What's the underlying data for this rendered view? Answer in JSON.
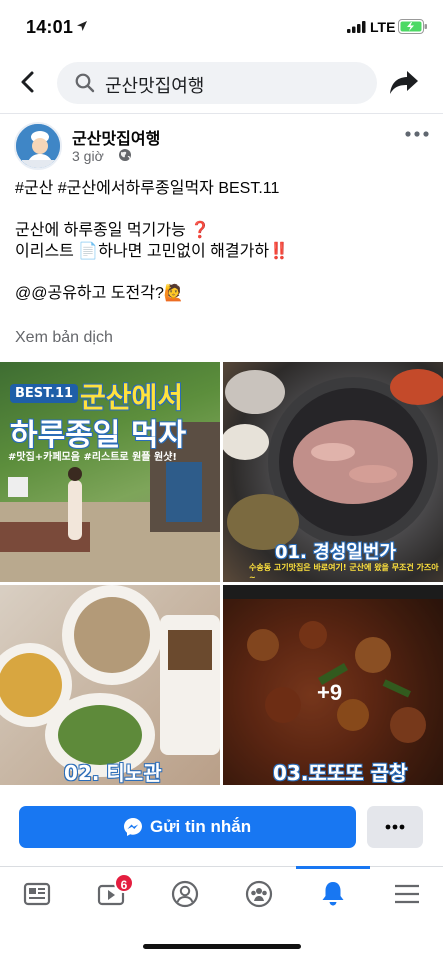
{
  "status_bar": {
    "time": "14:01",
    "network": "LTE",
    "battery_color": "#4cd964"
  },
  "search": {
    "query": "군산맛집여행"
  },
  "post": {
    "author": "군산맛집여행",
    "avatar_label": "맛집여행",
    "time": "3 giờ",
    "privacy_icon": "globe-icon",
    "lines": [
      "#군산 #군산에서하루종일먹자 BEST.11",
      "군산에 하루종일 먹기가능 ❓",
      "이리스트 📄하나면 고민없이 해결가하‼️",
      "@@공유하고 도전각?🙋"
    ],
    "see_translation": "Xem bản dịch",
    "photos": [
      {
        "badge": "BEST.11",
        "title_line1": "군산에서",
        "title_line2": "하루종일 먹자",
        "subtitle": "#맛집+카페모음 #리스트로 원플 원샷!"
      },
      {
        "caption": "01. 경성일번가",
        "subcaption": "수송동 고기맛집은 바로여기! 군산에 왔을 무조건 가즈아~"
      },
      {
        "caption": "02. 티노관"
      },
      {
        "caption": "03.또또또 곱창",
        "more_count": "+9"
      }
    ]
  },
  "actions": {
    "message_label": "Gửi tin nhắn",
    "more_label": "•••"
  },
  "tab_bar": {
    "accent_color": "#1877f2",
    "tabs": [
      {
        "name": "news-feed",
        "icon": "news-feed-icon"
      },
      {
        "name": "watch",
        "icon": "video-icon",
        "badge": "6"
      },
      {
        "name": "profile",
        "icon": "profile-icon"
      },
      {
        "name": "groups",
        "icon": "groups-icon"
      },
      {
        "name": "notifications",
        "icon": "bell-icon",
        "active": true
      },
      {
        "name": "menu",
        "icon": "menu-icon"
      }
    ]
  }
}
